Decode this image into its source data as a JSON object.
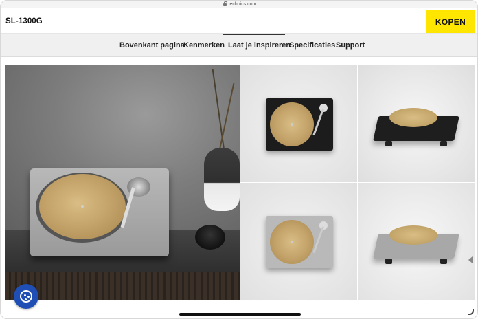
{
  "browser": {
    "url": "technics.com"
  },
  "header": {
    "product_name": "SL-1300G",
    "buy_label": "KOPEN"
  },
  "nav": {
    "items": [
      {
        "label": "Bovenkant pagina",
        "key": "top"
      },
      {
        "label": "Kenmerken",
        "key": "features"
      },
      {
        "label": "Laat je inspireren",
        "key": "inspire"
      },
      {
        "label": "Specificaties",
        "key": "specs"
      },
      {
        "label": "Support",
        "key": "support"
      }
    ],
    "active": "Laat je inspireren"
  },
  "gallery": {
    "images": [
      {
        "name": "turntable-lifestyle-silver"
      },
      {
        "name": "turntable-top-black"
      },
      {
        "name": "turntable-angle-black"
      },
      {
        "name": "turntable-top-silver"
      },
      {
        "name": "turntable-angle-silver"
      }
    ]
  },
  "colors": {
    "accent_yellow": "#ffe600",
    "cookie_blue": "#1f4fb5"
  },
  "icons": {
    "cookie": "cookie-icon",
    "lock": "lock-icon",
    "arrow": "chevron-left-icon"
  }
}
